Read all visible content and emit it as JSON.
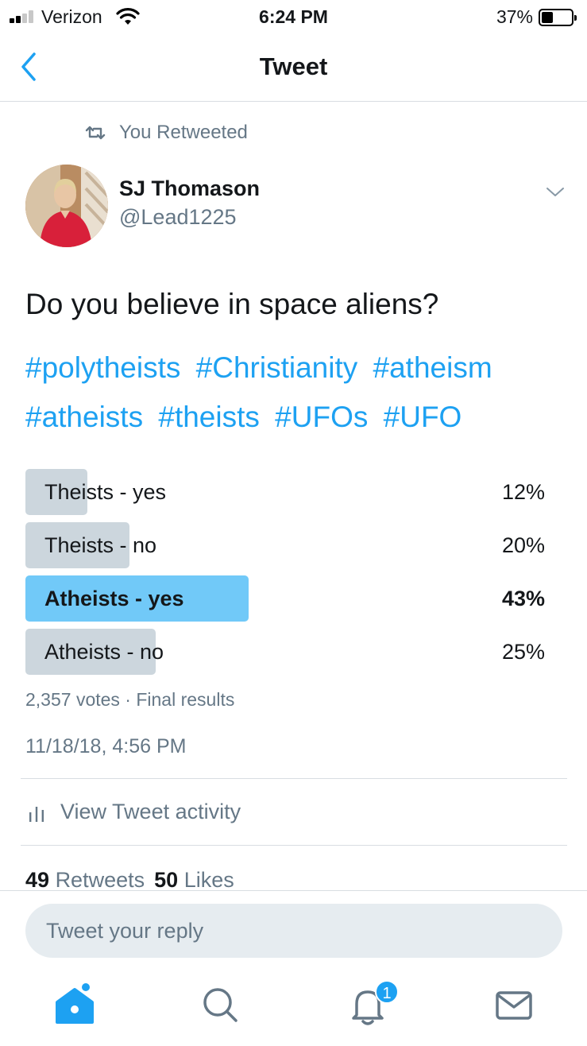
{
  "status_bar": {
    "carrier": "Verizon",
    "time": "6:24 PM",
    "battery_percent": "37%",
    "battery_level": 0.37,
    "signal_bars_filled": 2,
    "signal_bars_total": 4
  },
  "header": {
    "title": "Tweet",
    "back_icon": "chevron-left-icon"
  },
  "retweet_context": {
    "icon": "retweet-icon",
    "label": "You Retweeted"
  },
  "author": {
    "name": "SJ Thomason",
    "handle": "@Lead1225"
  },
  "tweet": {
    "text": "Do you believe in space aliens?",
    "hashtags": [
      "#polytheists",
      "#Christianity",
      "#atheism",
      "#atheists",
      "#theists",
      "#UFOs",
      "#UFO"
    ]
  },
  "poll": {
    "options": [
      {
        "label": "Theists - yes",
        "percent_text": "12%",
        "percent": 12,
        "winner": false
      },
      {
        "label": "Theists - no",
        "percent_text": "20%",
        "percent": 20,
        "winner": false
      },
      {
        "label": "Atheists - yes",
        "percent_text": "43%",
        "percent": 43,
        "winner": true
      },
      {
        "label": "Atheists - no",
        "percent_text": "25%",
        "percent": 25,
        "winner": false
      }
    ],
    "summary": "2,357 votes · Final results"
  },
  "timestamp": "11/18/18, 4:56 PM",
  "activity": {
    "label": "View Tweet activity",
    "icon": "bar-chart-icon"
  },
  "stats": {
    "retweets_count": "49",
    "retweets_label": "Retweets",
    "likes_count": "50",
    "likes_label": "Likes"
  },
  "reply": {
    "placeholder": "Tweet your reply"
  },
  "tab_bar": {
    "tabs": [
      "home-icon",
      "search-icon",
      "notifications-icon",
      "messages-icon"
    ],
    "notification_badge": "1"
  },
  "colors": {
    "accent": "#1da1f2",
    "muted_text": "#657786",
    "poll_bar": "#ccd6dd",
    "poll_winner_bar": "#71c9f8"
  }
}
